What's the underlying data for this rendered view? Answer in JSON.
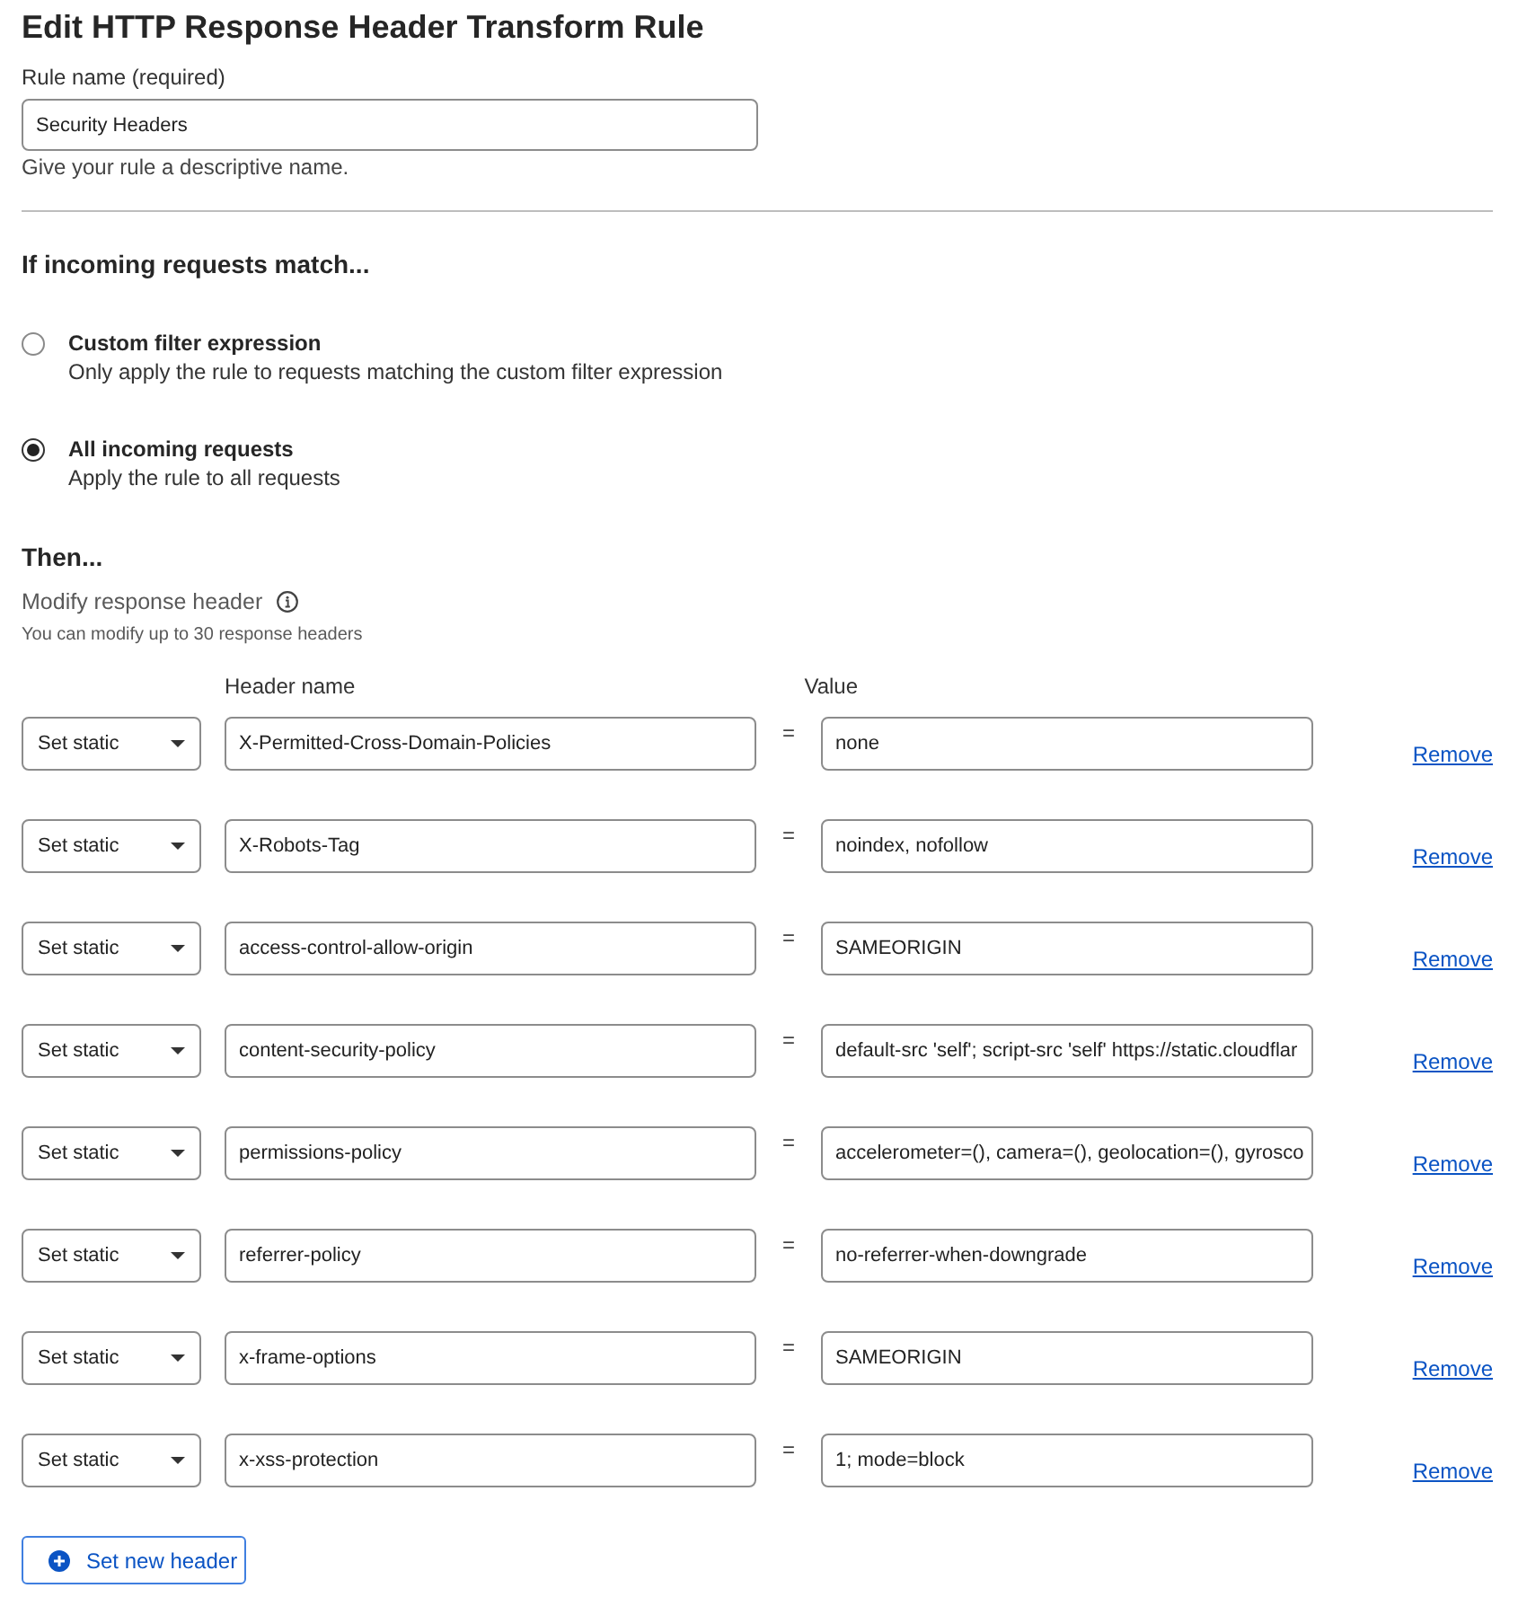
{
  "title": "Edit HTTP Response Header Transform Rule",
  "rule_name": {
    "label": "Rule name (required)",
    "value": "Security Headers",
    "hint": "Give your rule a descriptive name."
  },
  "match": {
    "heading": "If incoming requests match...",
    "options": [
      {
        "label": "Custom filter expression",
        "description": "Only apply the rule to requests matching the custom filter expression",
        "selected": false
      },
      {
        "label": "All incoming requests",
        "description": "Apply the rule to all requests",
        "selected": true
      }
    ]
  },
  "then": {
    "heading": "Then...",
    "section_label": "Modify response header",
    "note": "You can modify up to 30 response headers",
    "columns": [
      "Header name",
      "Value"
    ],
    "headers": [
      {
        "action": "Set static",
        "name": "X-Permitted-Cross-Domain-Policies",
        "operator": "=",
        "value": "none",
        "remove": "Remove"
      },
      {
        "action": "Set static",
        "name": "X-Robots-Tag",
        "operator": "=",
        "value": "noindex, nofollow",
        "remove": "Remove"
      },
      {
        "action": "Set static",
        "name": "access-control-allow-origin",
        "operator": "=",
        "value": "SAMEORIGIN",
        "remove": "Remove"
      },
      {
        "action": "Set static",
        "name": "content-security-policy",
        "operator": "=",
        "value": "default-src 'self'; script-src 'self' https://static.cloudflar",
        "remove": "Remove"
      },
      {
        "action": "Set static",
        "name": "permissions-policy",
        "operator": "=",
        "value": "accelerometer=(), camera=(), geolocation=(), gyrosco",
        "remove": "Remove"
      },
      {
        "action": "Set static",
        "name": "referrer-policy",
        "operator": "=",
        "value": "no-referrer-when-downgrade",
        "remove": "Remove"
      },
      {
        "action": "Set static",
        "name": "x-frame-options",
        "operator": "=",
        "value": "SAMEORIGIN",
        "remove": "Remove"
      },
      {
        "action": "Set static",
        "name": "x-xss-protection",
        "operator": "=",
        "value": "1; mode=block",
        "remove": "Remove"
      }
    ],
    "add_button": "Set new header"
  }
}
